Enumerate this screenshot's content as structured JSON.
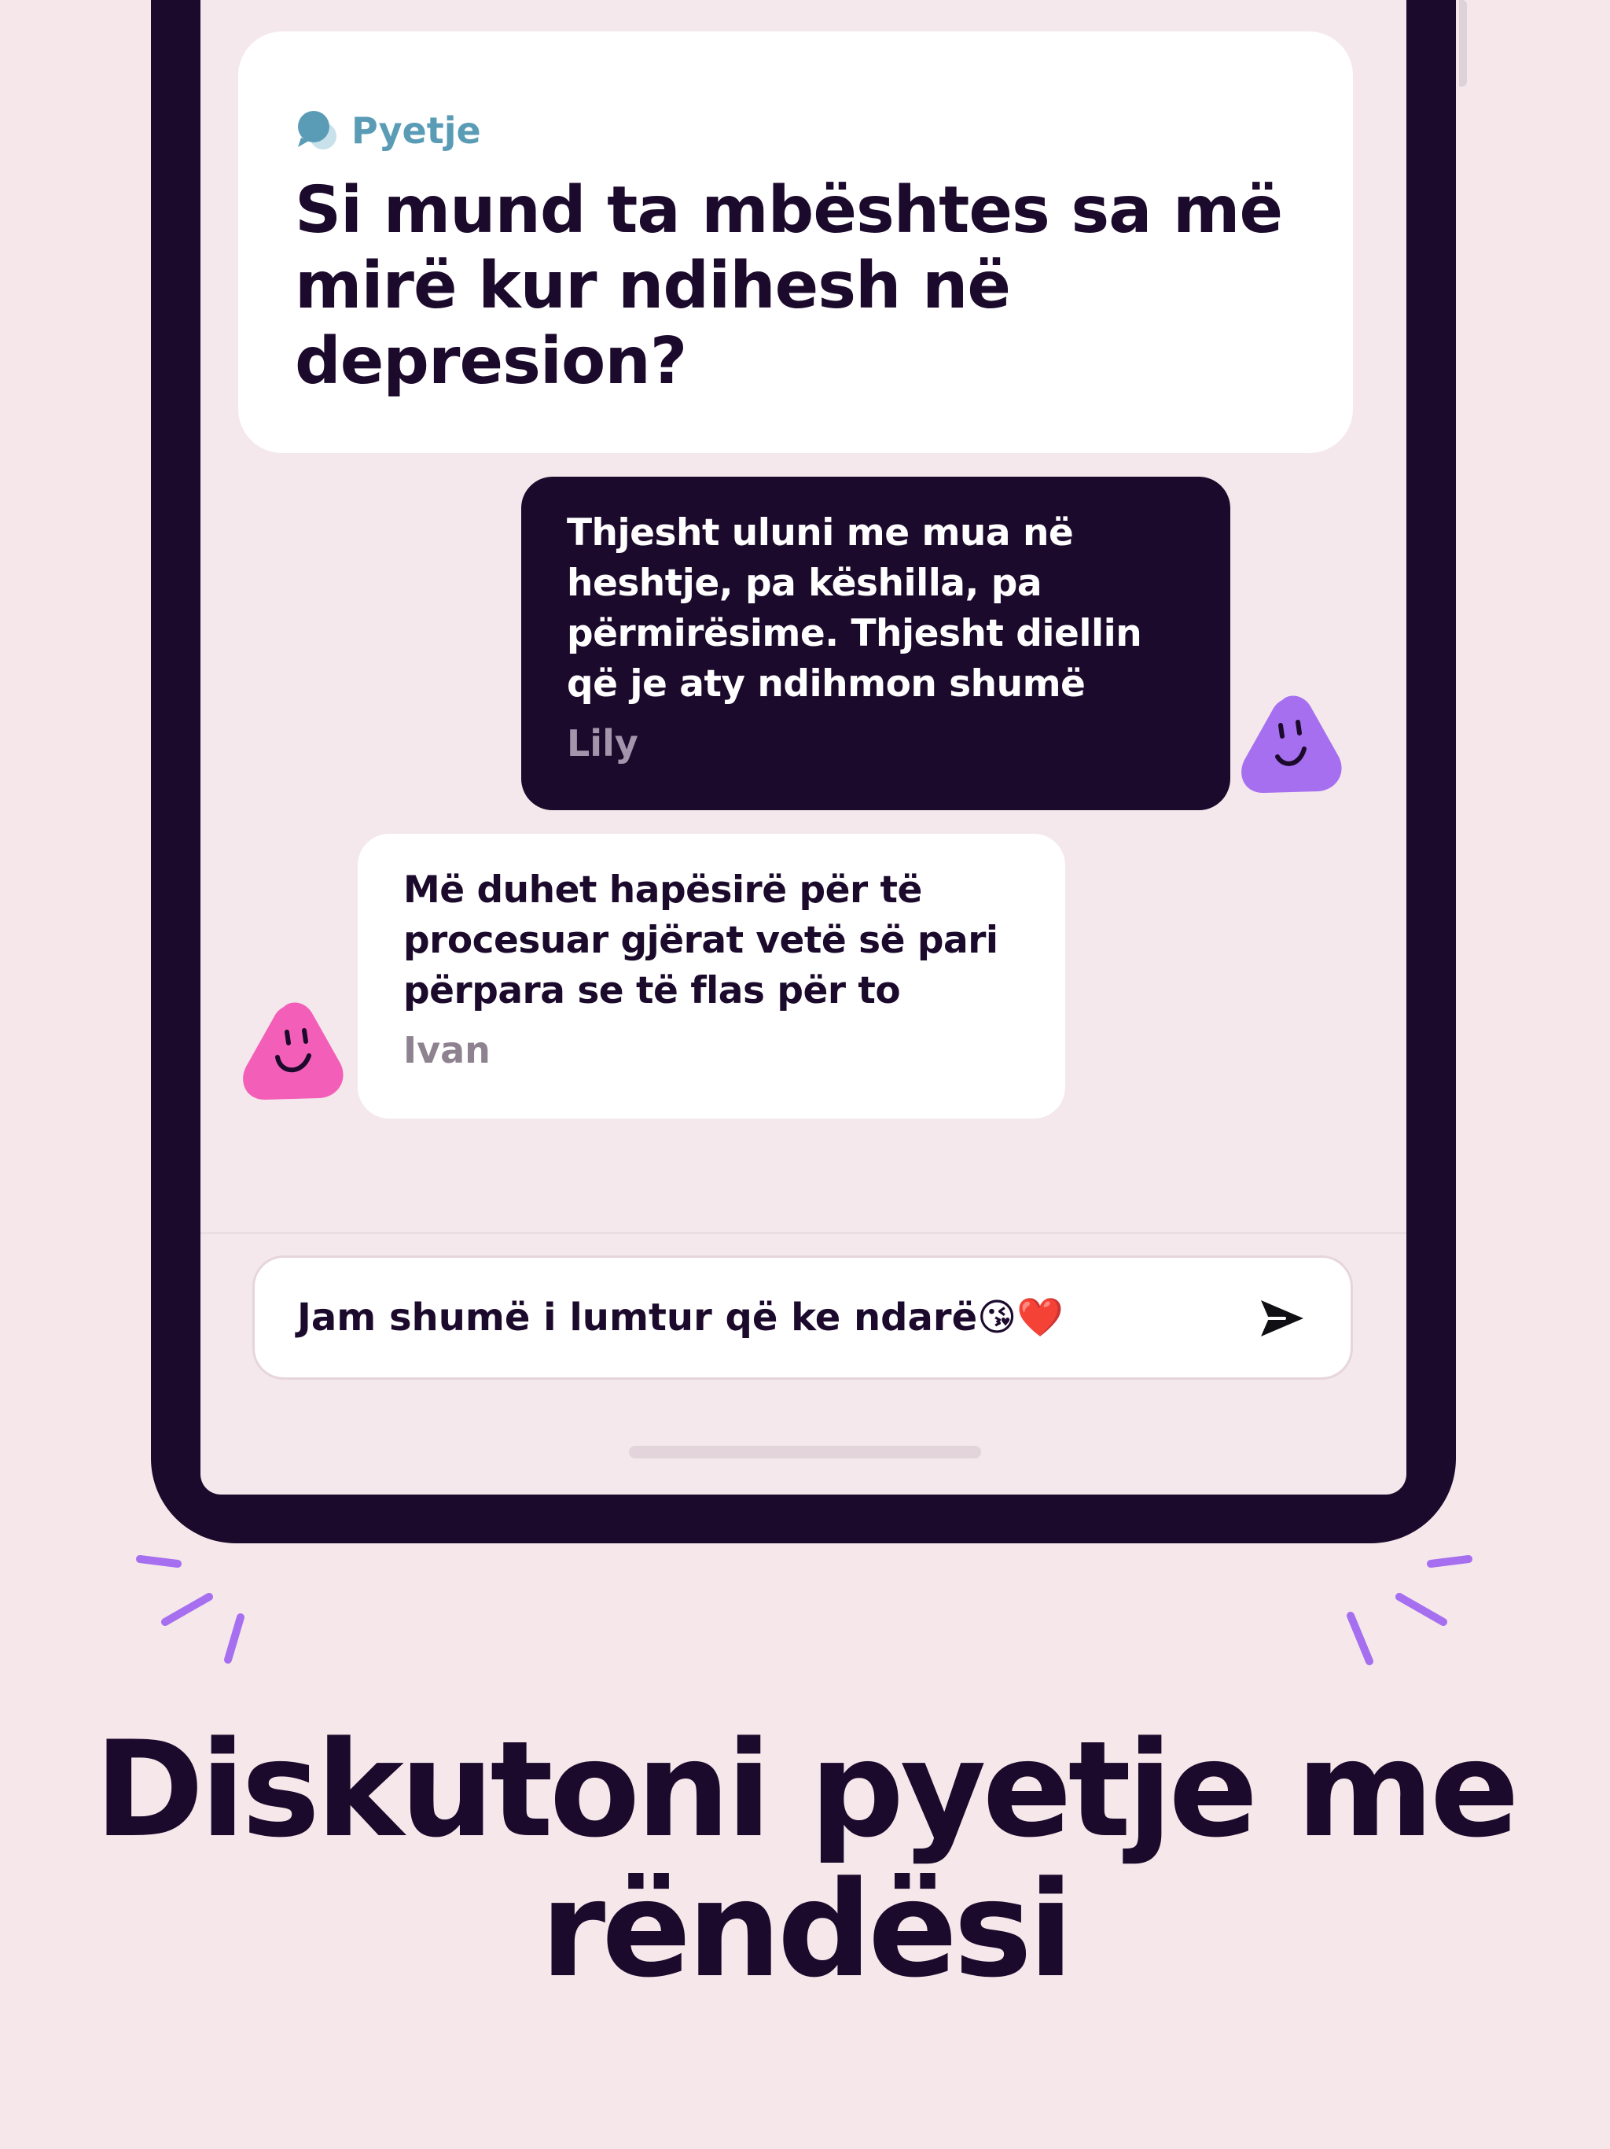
{
  "question": {
    "label": "Pyetje",
    "text": "Si mund ta mbështes sa më mirë kur ndihesh në depresion?",
    "icon": "speech-bubbles-icon"
  },
  "messages": [
    {
      "text": "Thjesht uluni me mua në heshtje, pa këshilla, pa përmirësime. Thjesht diellin që je aty ndihmon shumë",
      "author": "Lily",
      "avatar_color": "#a66ff0",
      "style": "dark"
    },
    {
      "text": "Më duhet hapësirë për të procesuar gjërat vetë së pari përpara se të flas për to",
      "author": "Ivan",
      "avatar_color": "#f35fb8",
      "style": "light"
    }
  ],
  "composer": {
    "value": "Jam shumë i lumtur që ke ndarë😘❤️",
    "send_icon": "send-arrow-icon"
  },
  "headline": "Diskutoni pyetje me rëndësi",
  "colors": {
    "background": "#f5e7ea",
    "device": "#1c0a2c",
    "accent_blue": "#5a9cb5",
    "spark_purple": "#a66ff0"
  }
}
